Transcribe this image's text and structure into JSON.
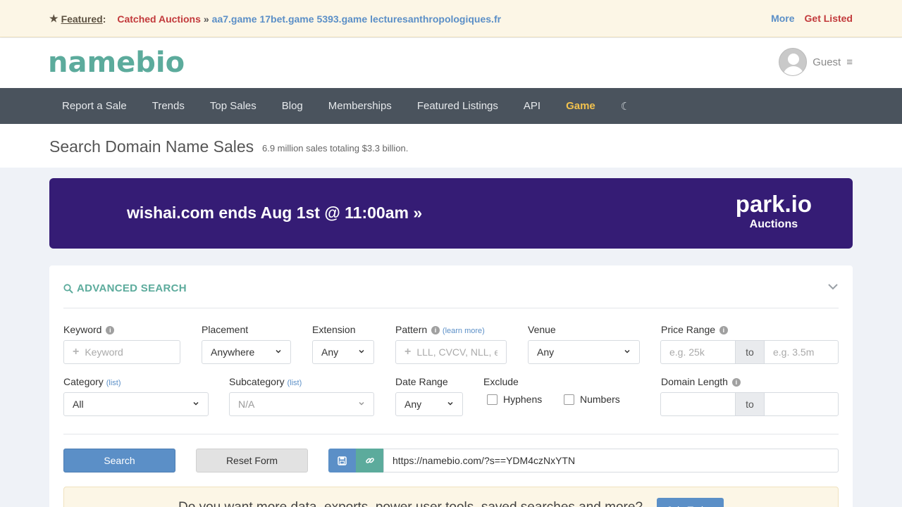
{
  "featured": {
    "label": "Featured",
    "colon": ":",
    "auctions": "Catched Auctions",
    "separator": "»",
    "domains": [
      "aa7.game",
      "17bet.game",
      "5393.game",
      "lecturesanthropologiques.fr"
    ],
    "more": "More",
    "get_listed": "Get Listed"
  },
  "header": {
    "logo": "namebio",
    "user": "Guest",
    "menu_glyph": "≡"
  },
  "nav": {
    "items": [
      "Report a Sale",
      "Trends",
      "Top Sales",
      "Blog",
      "Memberships",
      "Featured Listings",
      "API",
      "Game"
    ],
    "moon": "☾"
  },
  "title": {
    "main": "Search Domain Name Sales",
    "sub": "6.9 million sales totaling $3.3 billion."
  },
  "banner": {
    "text": "wishai.com ends Aug 1st @ 11:00am »",
    "brand": "park.io",
    "brand_sub": "Auctions"
  },
  "search": {
    "heading": "ADVANCED SEARCH",
    "keyword_label": "Keyword",
    "keyword_placeholder": "Keyword",
    "placement_label": "Placement",
    "placement_value": "Anywhere",
    "extension_label": "Extension",
    "extension_value": "Any",
    "pattern_label": "Pattern",
    "pattern_link": "learn more",
    "pattern_placeholder": "LLL, CVCV, NLL, e",
    "venue_label": "Venue",
    "venue_value": "Any",
    "price_label": "Price Range",
    "price_from_placeholder": "e.g. 25k",
    "price_to": "to",
    "price_to_placeholder": "e.g. 3.5m",
    "category_label": "Category",
    "category_link": "list",
    "category_value": "All",
    "subcategory_label": "Subcategory",
    "subcategory_link": "list",
    "subcategory_value": "N/A",
    "date_label": "Date Range",
    "date_value": "Any",
    "exclude_label": "Exclude",
    "exclude_hyphens": "Hyphens",
    "exclude_numbers": "Numbers",
    "length_label": "Domain Length",
    "length_to": "to",
    "search_button": "Search",
    "reset_button": "Reset Form",
    "url_value": "https://namebio.com/?s==YDM4czNxYTN"
  },
  "upsell": {
    "text": "Do you want more data, exports, power user tools, saved searches and more?",
    "button": "Join Today"
  },
  "colors": {
    "accent_green": "#5cab9c",
    "link_blue": "#5b8fc7",
    "alert_red": "#c2393b",
    "nav_bg": "#4a535d",
    "game_gold": "#f2c24e",
    "banner_purple": "#351c75"
  },
  "icons": [
    "star-icon",
    "user-avatar-icon",
    "hamburger-icon",
    "moon-icon",
    "search-icon",
    "chevron-down-icon",
    "info-icon",
    "plus-icon",
    "save-icon",
    "link-icon"
  ]
}
